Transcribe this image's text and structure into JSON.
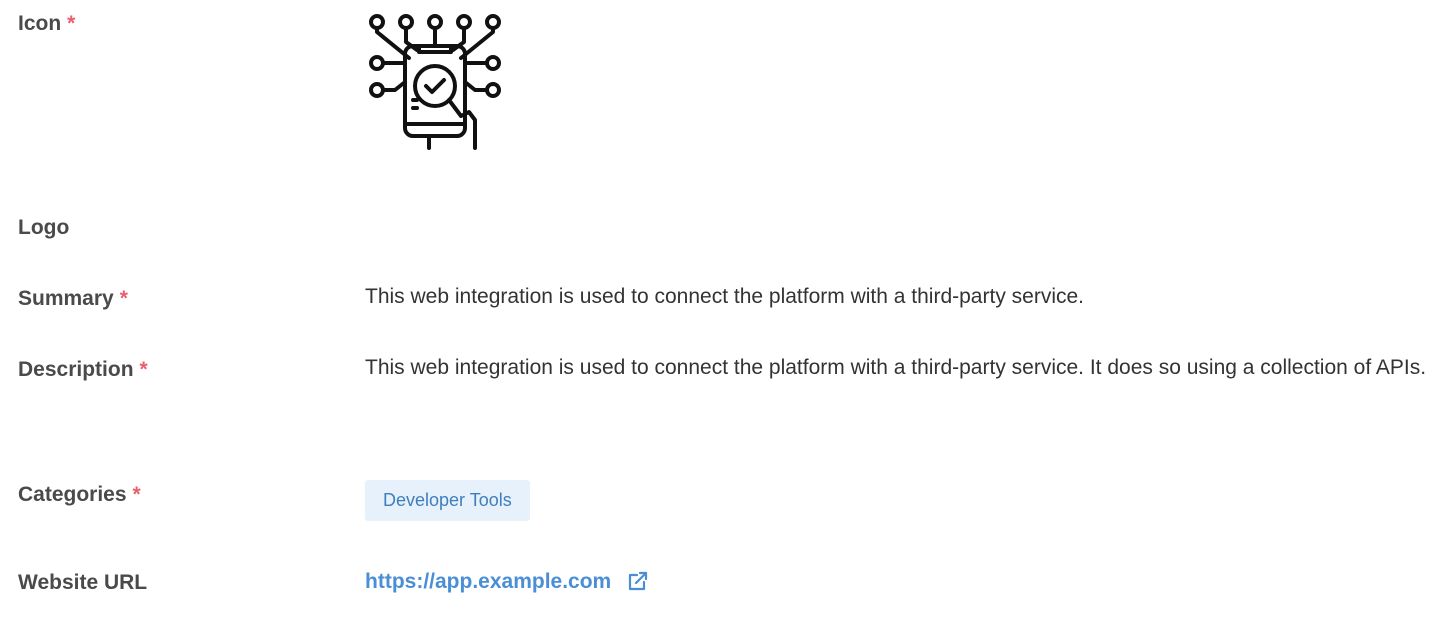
{
  "fields": {
    "icon": {
      "label": "Icon",
      "required_mark": "*",
      "image": "integration-circuit-phone-icon"
    },
    "logo": {
      "label": "Logo"
    },
    "summary": {
      "label": "Summary",
      "required_mark": "*",
      "value": "This web integration is used to connect the platform with a third-party service."
    },
    "description": {
      "label": "Description",
      "required_mark": "*",
      "value": "This web integration is used to connect the platform with a third-party service. It does so using a collection of APIs."
    },
    "categories": {
      "label": "Categories",
      "required_mark": "*",
      "items": [
        "Developer Tools"
      ]
    },
    "website": {
      "label": "Website URL",
      "url": "https://app.example.com",
      "icon": "external-link-icon"
    }
  },
  "colors": {
    "required": "#e8606d",
    "link": "#4a8fd6",
    "chip_bg": "#e7f1fb",
    "chip_text": "#3f7ebd"
  }
}
